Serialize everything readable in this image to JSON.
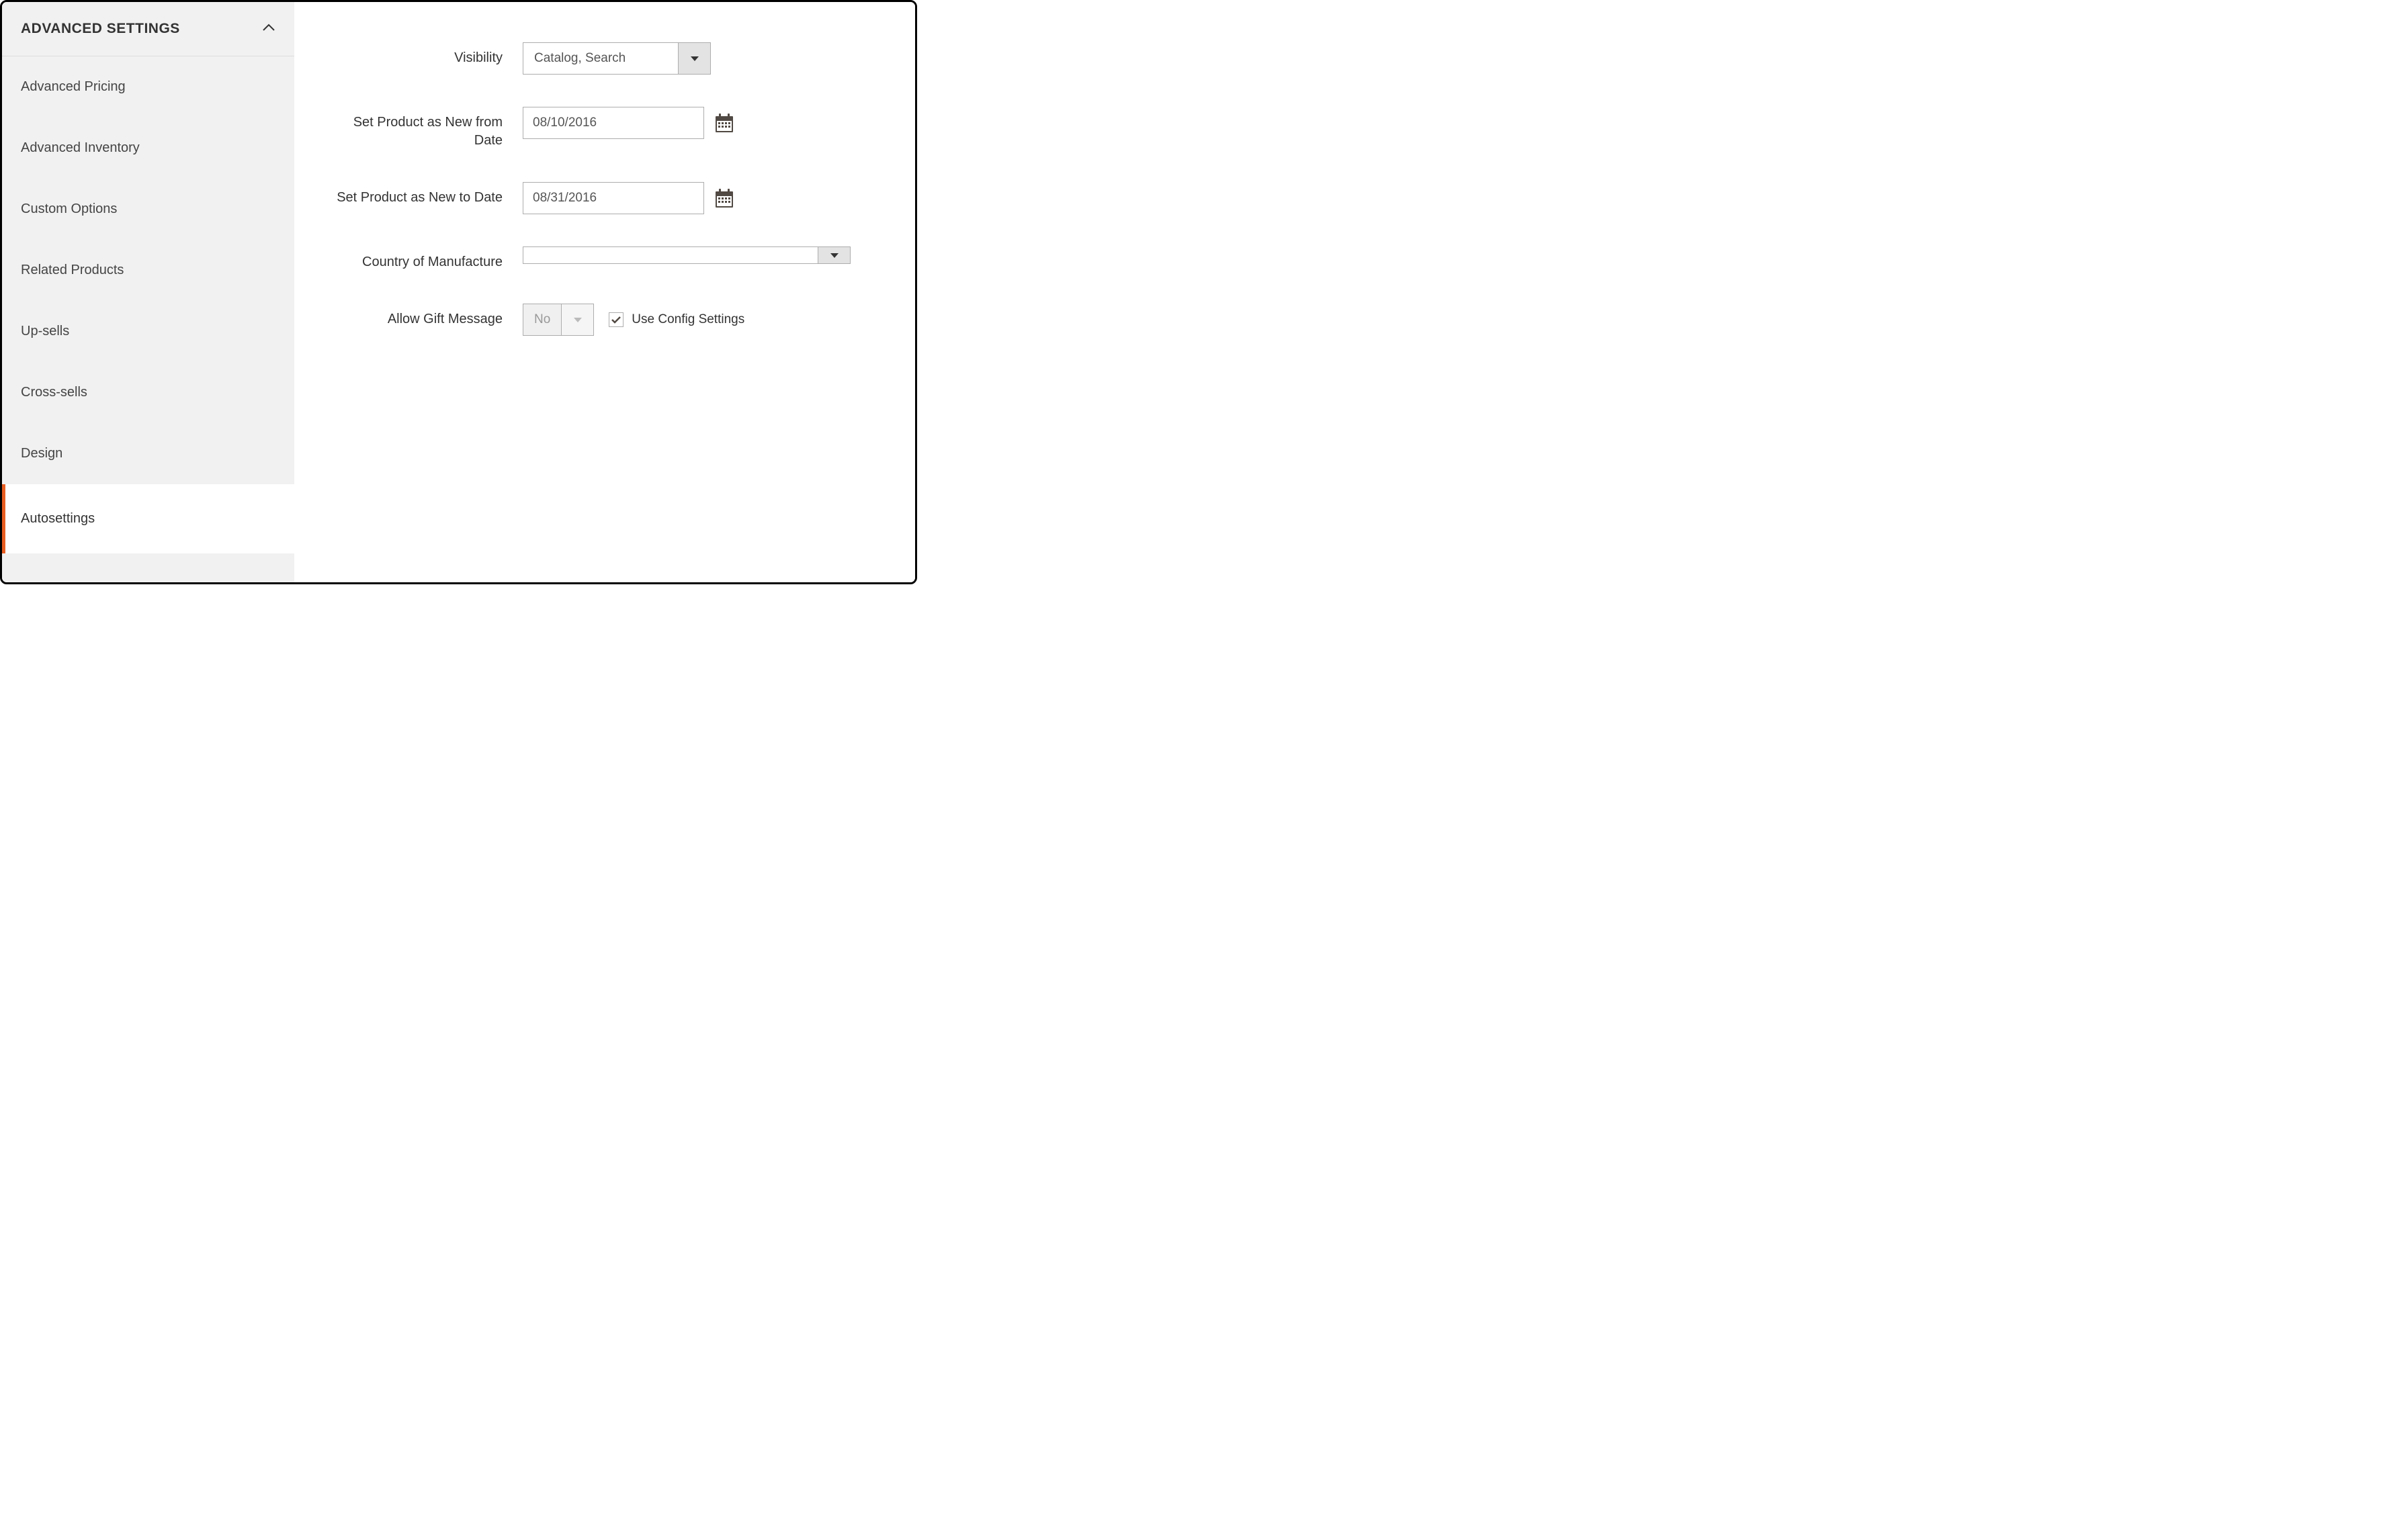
{
  "sidebar": {
    "header": "ADVANCED SETTINGS",
    "items": [
      {
        "label": "Advanced Pricing"
      },
      {
        "label": "Advanced Inventory"
      },
      {
        "label": "Custom Options"
      },
      {
        "label": "Related Products"
      },
      {
        "label": "Up-sells"
      },
      {
        "label": "Cross-sells"
      },
      {
        "label": "Design"
      },
      {
        "label": "Autosettings"
      }
    ]
  },
  "form": {
    "visibility": {
      "label": "Visibility",
      "value": "Catalog, Search"
    },
    "new_from": {
      "label": "Set Product as New from Date",
      "value": "08/10/2016"
    },
    "new_to": {
      "label": "Set Product as New to Date",
      "value": "08/31/2016"
    },
    "country": {
      "label": "Country of Manufacture",
      "value": ""
    },
    "gift": {
      "label": "Allow Gift Message",
      "value": "No",
      "use_config_label": "Use Config Settings"
    }
  }
}
